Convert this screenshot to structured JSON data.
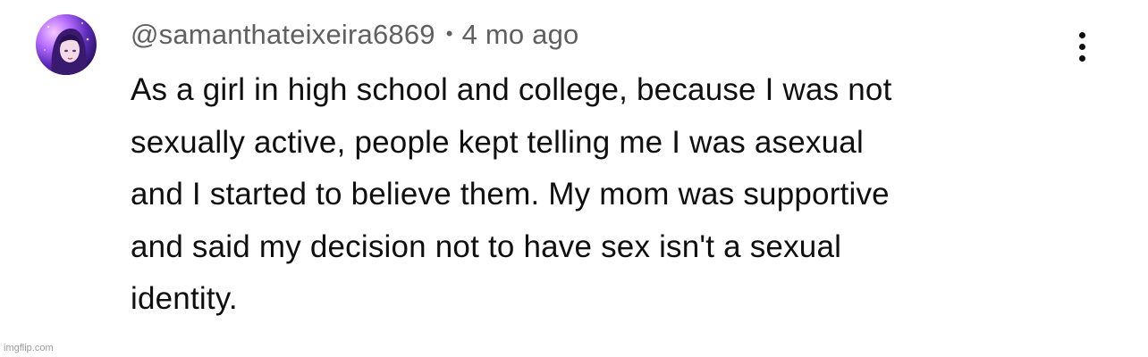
{
  "comment": {
    "username": "@samanthateixeira6869",
    "separator": "•",
    "timestamp": "4 mo ago",
    "text_lines": [
      "As a girl in high school and college, because I was not",
      "sexually active, people kept telling me I was asexual",
      "and I started to believe them. My mom was supportive",
      "and said my decision not to have sex isn't a sexual",
      "identity."
    ],
    "avatar_icon": "user-avatar",
    "menu_icon": "more-vertical-icon"
  },
  "watermark": "imgflip.com",
  "colors": {
    "text": "#0f0f0f",
    "meta": "#606060",
    "background": "#ffffff"
  }
}
